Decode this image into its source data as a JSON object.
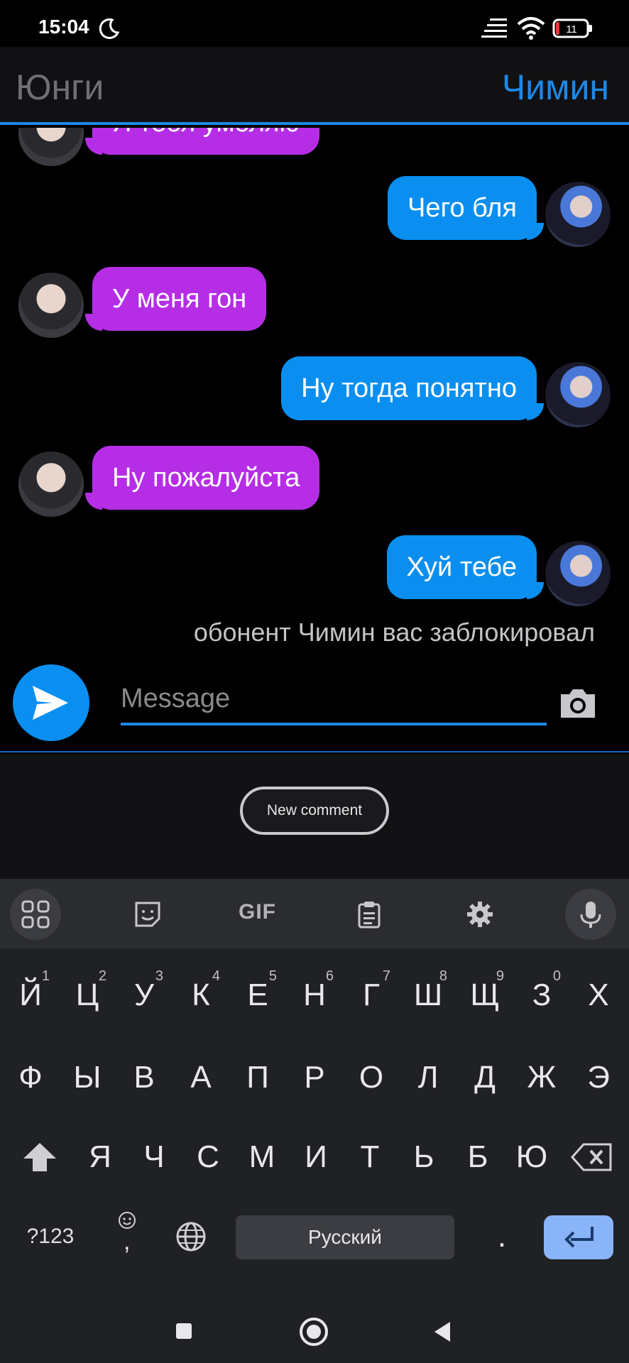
{
  "status_bar": {
    "time": "15:04",
    "battery": "11"
  },
  "header": {
    "left_contact": "Юнги",
    "right_contact": "Чимин"
  },
  "messages": [
    {
      "side": "left",
      "text": "Я тебя умоляю"
    },
    {
      "side": "right",
      "text": "Чего бля"
    },
    {
      "side": "left",
      "text": "У меня гон"
    },
    {
      "side": "right",
      "text": "Ну тогда понятно"
    },
    {
      "side": "left",
      "text": "Ну пожалуйста"
    },
    {
      "side": "right",
      "text": "Хуй тебе"
    }
  ],
  "system_message": "обонент Чимин вас заблокировал",
  "composer": {
    "placeholder": "Message"
  },
  "comment_button": "New comment",
  "keyboard": {
    "toolbar": {
      "gif": "GIF"
    },
    "row1": [
      {
        "k": "Й",
        "n": "1"
      },
      {
        "k": "Ц",
        "n": "2"
      },
      {
        "k": "У",
        "n": "3"
      },
      {
        "k": "К",
        "n": "4"
      },
      {
        "k": "Е",
        "n": "5"
      },
      {
        "k": "Н",
        "n": "6"
      },
      {
        "k": "Г",
        "n": "7"
      },
      {
        "k": "Ш",
        "n": "8"
      },
      {
        "k": "Щ",
        "n": "9"
      },
      {
        "k": "З",
        "n": "0"
      },
      {
        "k": "Х",
        "n": ""
      }
    ],
    "row2": [
      "Ф",
      "Ы",
      "В",
      "А",
      "П",
      "Р",
      "О",
      "Л",
      "Д",
      "Ж",
      "Э"
    ],
    "row3": [
      "Я",
      "Ч",
      "С",
      "М",
      "И",
      "Т",
      "Ь",
      "Б",
      "Ю"
    ],
    "symbols": "?123",
    "comma": ",",
    "space": "Русский",
    "period": "."
  },
  "colors": {
    "accent": "#1e88e5",
    "left_bubble": "#b52ee6",
    "right_bubble": "#0a8ff0"
  },
  "icons": [
    "moon-icon",
    "signal-icon",
    "wifi-icon",
    "battery-icon",
    "send-icon",
    "camera-icon",
    "apps-grid-icon",
    "sticker-icon",
    "clipboard-icon",
    "settings-gear-icon",
    "microphone-icon",
    "shift-icon",
    "backspace-icon",
    "emoji-icon",
    "globe-icon",
    "enter-icon"
  ]
}
